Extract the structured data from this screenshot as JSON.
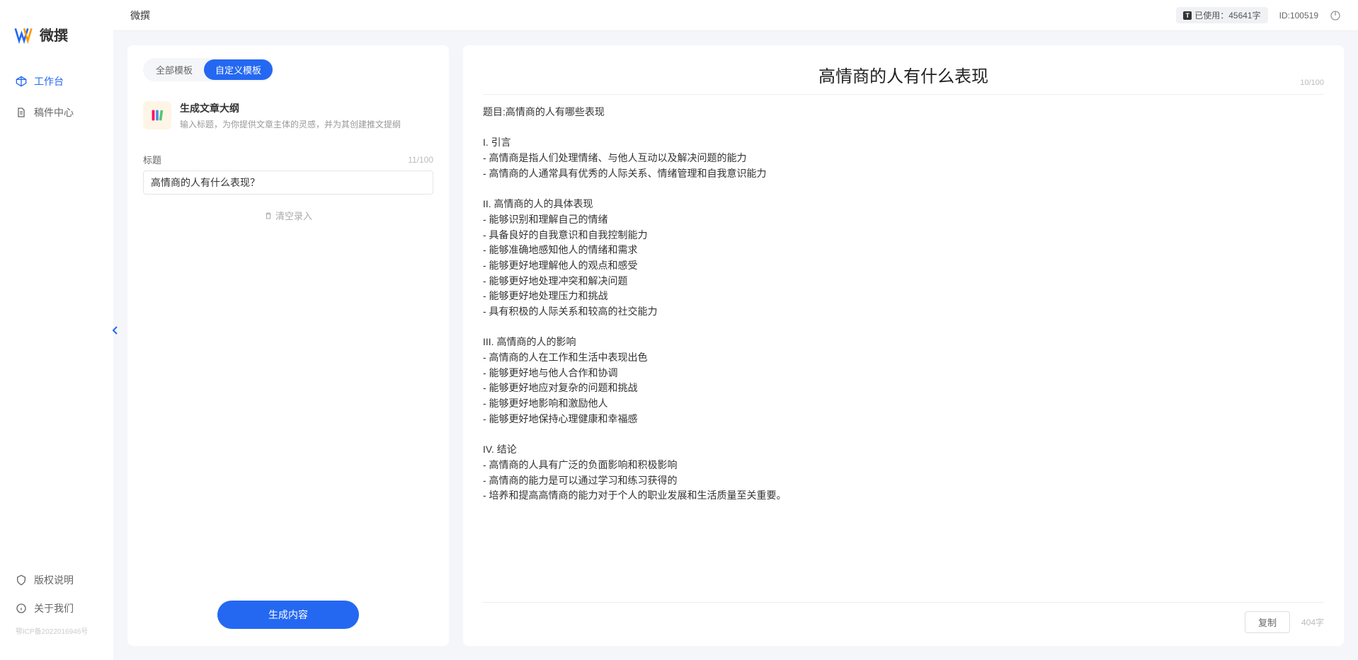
{
  "app": {
    "name": "微撰",
    "logo_text": "微撰"
  },
  "header": {
    "breadcrumb": "微撰",
    "usage_label": "已使用：45641字",
    "user_id": "ID:100519"
  },
  "sidebar": {
    "items": [
      {
        "label": "工作台",
        "active": true
      },
      {
        "label": "稿件中心",
        "active": false
      }
    ],
    "bottom": [
      {
        "label": "版权说明"
      },
      {
        "label": "关于我们"
      }
    ],
    "icp": "鄂ICP备2022016946号"
  },
  "left": {
    "tabs": [
      {
        "label": "全部模板",
        "active": false
      },
      {
        "label": "自定义模板",
        "active": true
      }
    ],
    "template": {
      "title": "生成文章大纲",
      "desc": "输入标题，为你提供文章主体的灵感，并为其创建推文提纲",
      "icon_name": "books-icon"
    },
    "fields": {
      "title_label": "标题",
      "title_count": "11/100",
      "title_value": "高情商的人有什么表现？"
    },
    "clear_label": "清空录入",
    "generate_label": "生成内容"
  },
  "right": {
    "title": "高情商的人有什么表现",
    "title_count": "10/100",
    "body": "题目:高情商的人有哪些表现\n\nI. 引言\n- 高情商是指人们处理情绪、与他人互动以及解决问题的能力\n- 高情商的人通常具有优秀的人际关系、情绪管理和自我意识能力\n\nII. 高情商的人的具体表现\n- 能够识别和理解自己的情绪\n- 具备良好的自我意识和自我控制能力\n- 能够准确地感知他人的情绪和需求\n- 能够更好地理解他人的观点和感受\n- 能够更好地处理冲突和解决问题\n- 能够更好地处理压力和挑战\n- 具有积极的人际关系和较高的社交能力\n\nIII. 高情商的人的影响\n- 高情商的人在工作和生活中表现出色\n- 能够更好地与他人合作和协调\n- 能够更好地应对复杂的问题和挑战\n- 能够更好地影响和激励他人\n- 能够更好地保持心理健康和幸福感\n\nIV. 结论\n- 高情商的人具有广泛的负面影响和积极影响\n- 高情商的能力是可以通过学习和练习获得的\n- 培养和提高高情商的能力对于个人的职业发展和生活质量至关重要。",
    "copy_label": "复制",
    "word_count": "404字"
  }
}
